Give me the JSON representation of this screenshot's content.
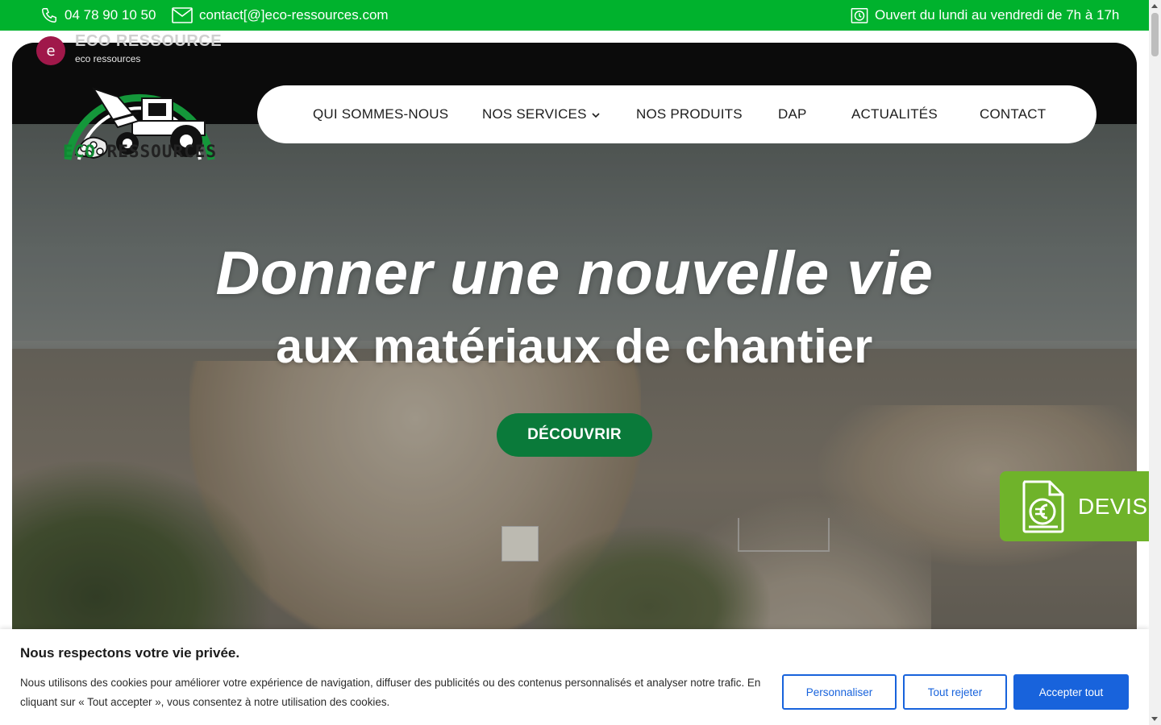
{
  "topbar": {
    "phone": "04 78 90 10 50",
    "email": "contact[@]eco-ressources.com",
    "hours": "Ouvert du lundi au vendredi de 7h à 17h",
    "icons": [
      "phone-icon",
      "envelope-icon",
      "clock-icon"
    ],
    "background_color": "#00b22d"
  },
  "site": {
    "badge_letter": "e",
    "name": "ECO RESSOURCE",
    "tagline": "eco ressources",
    "logo_word_1": "ECO",
    "logo_word_2": "RESSOURCES",
    "brand_green": "#0f8a32"
  },
  "nav": {
    "items": [
      {
        "label": "QUI SOMMES-NOUS"
      },
      {
        "label": "NOS SERVICES",
        "has_dropdown": true
      },
      {
        "label": "NOS PRODUITS"
      },
      {
        "label": "DAP"
      },
      {
        "label": "ACTUALITÉS"
      },
      {
        "label": "CONTACT"
      }
    ]
  },
  "hero": {
    "title": "Donner une nouvelle vie",
    "subtitle": "aux matériaux de chantier",
    "cta_label": "DÉCOUVRIR",
    "cta_color": "#0a7a3a"
  },
  "devis": {
    "label": "DEVIS",
    "icon": "euro-document-icon",
    "color": "#6fb32a"
  },
  "cookie": {
    "title": "Nous respectons votre vie privée.",
    "text": "Nous utilisons des cookies pour améliorer votre expérience de navigation, diffuser des publicités ou des contenus personnalisés et analyser notre trafic. En cliquant sur « Tout accepter », vous consentez à notre utilisation des cookies.",
    "customize_label": "Personnaliser",
    "reject_label": "Tout rejeter",
    "accept_label": "Accepter tout",
    "accent_color": "#1863dc"
  }
}
